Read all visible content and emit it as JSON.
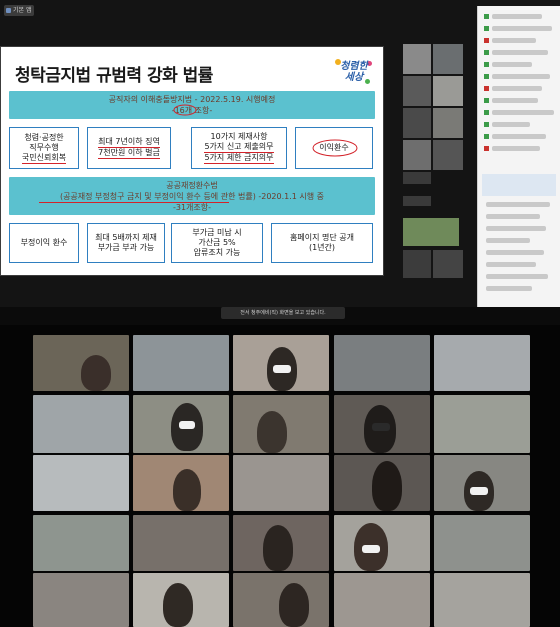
{
  "window": {
    "tab_label": "기본 앱"
  },
  "slide": {
    "title": "청탁금지법 규범력 강화 법률",
    "logo_text": "청렴한 세상",
    "band1": {
      "line1": "공직자의 이해충돌방지법 - 2022.5.19. 시행예정",
      "line2": "-16개 조항-"
    },
    "boxes_row1": [
      {
        "lines": [
          "청렴·공정한",
          "직무수행",
          "국민신뢰회복"
        ]
      },
      {
        "lines": [
          "최대 7년이하 징역",
          "7천만원 이하 벌금"
        ]
      },
      {
        "lines": [
          "10가지 제재사항",
          "5가지 신고 제출의무",
          "5가지 제한 금지의무"
        ]
      },
      {
        "lines": [
          "이익환수"
        ]
      }
    ],
    "band2": {
      "line1": "공공재정환수법",
      "line2": "(공공재정 부정청구 금지 및 부정이익 환수 등에 관한 법률) -2020.1.1 시행 중",
      "line3": "-31개조항-"
    },
    "boxes_row2": [
      {
        "lines": [
          "부정이익 환수"
        ]
      },
      {
        "lines": [
          "최대 5배까지 제재",
          "부가금 부과 가능"
        ]
      },
      {
        "lines": [
          "부가금 미납 시",
          "가산금 5%",
          "압류조치 가능"
        ]
      },
      {
        "lines": [
          "홈페이지 명단 공개",
          "(1년간)"
        ]
      }
    ]
  },
  "screen_share": {
    "status_text": "전서 청주에비(직) 화면을 보고 있습니다."
  },
  "colors": {
    "band": "#5bc1cf",
    "box_border": "#2f7fc0",
    "annotation": "#d3232a"
  }
}
